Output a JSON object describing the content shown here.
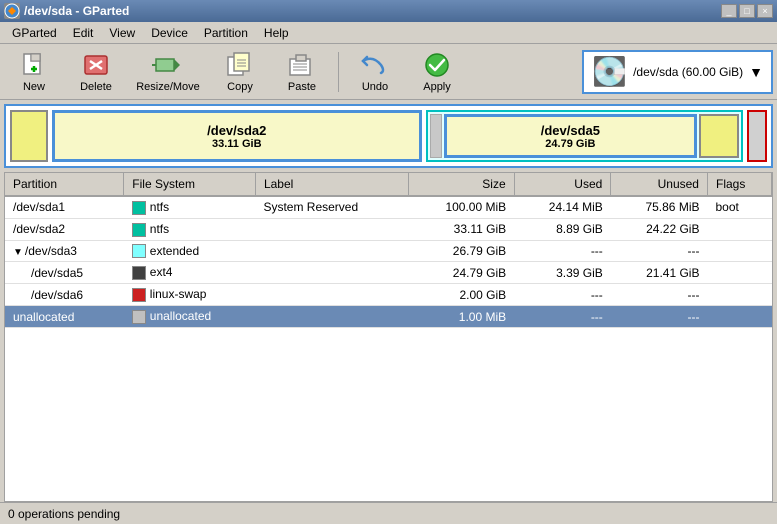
{
  "titlebar": {
    "title": "/dev/sda - GParted",
    "icon": "gparted-icon"
  },
  "menubar": {
    "items": [
      "GParted",
      "Edit",
      "View",
      "Device",
      "Partition",
      "Help"
    ]
  },
  "toolbar": {
    "buttons": [
      {
        "id": "new",
        "label": "New",
        "icon": "new-icon",
        "disabled": false
      },
      {
        "id": "delete",
        "label": "Delete",
        "icon": "delete-icon",
        "disabled": false
      },
      {
        "id": "resize",
        "label": "Resize/Move",
        "icon": "resize-icon",
        "disabled": false
      },
      {
        "id": "copy",
        "label": "Copy",
        "icon": "copy-icon",
        "disabled": false
      },
      {
        "id": "paste",
        "label": "Paste",
        "icon": "paste-icon",
        "disabled": false
      },
      {
        "id": "undo",
        "label": "Undo",
        "icon": "undo-icon",
        "disabled": false
      },
      {
        "id": "apply",
        "label": "Apply",
        "icon": "apply-icon",
        "disabled": false
      }
    ]
  },
  "device_selector": {
    "name": "/dev/sda",
    "size": "(60.00 GiB)"
  },
  "disk_visual": {
    "sda2_label": "/dev/sda2",
    "sda2_size": "33.11 GiB",
    "sda5_label": "/dev/sda5",
    "sda5_size": "24.79 GiB"
  },
  "table": {
    "headers": [
      "Partition",
      "File System",
      "Label",
      "Size",
      "Used",
      "Unused",
      "Flags"
    ],
    "rows": [
      {
        "partition": "/dev/sda1",
        "fs": "ntfs",
        "fs_color": "#00c0a0",
        "label": "System Reserved",
        "size": "100.00 MiB",
        "used": "24.14 MiB",
        "unused": "75.86 MiB",
        "flags": "boot",
        "indent": false,
        "tree": false,
        "selected": false
      },
      {
        "partition": "/dev/sda2",
        "fs": "ntfs",
        "fs_color": "#00c0a0",
        "label": "",
        "size": "33.11 GiB",
        "used": "8.89 GiB",
        "unused": "24.22 GiB",
        "flags": "",
        "indent": false,
        "tree": false,
        "selected": false
      },
      {
        "partition": "/dev/sda3",
        "fs": "extended",
        "fs_color": "#80ffff",
        "label": "",
        "size": "26.79 GiB",
        "used": "---",
        "unused": "---",
        "flags": "",
        "indent": false,
        "tree": true,
        "selected": false
      },
      {
        "partition": "/dev/sda5",
        "fs": "ext4",
        "fs_color": "#404040",
        "label": "",
        "size": "24.79 GiB",
        "used": "3.39 GiB",
        "unused": "21.41 GiB",
        "flags": "",
        "indent": true,
        "tree": false,
        "selected": false
      },
      {
        "partition": "/dev/sda6",
        "fs": "linux-swap",
        "fs_color": "#cc2020",
        "label": "",
        "size": "2.00 GiB",
        "used": "---",
        "unused": "---",
        "flags": "",
        "indent": true,
        "tree": false,
        "selected": false
      },
      {
        "partition": "unallocated",
        "fs": "unallocated",
        "fs_color": "#c0c0c0",
        "label": "",
        "size": "1.00 MiB",
        "used": "---",
        "unused": "---",
        "flags": "",
        "indent": false,
        "tree": false,
        "selected": true
      }
    ]
  },
  "statusbar": {
    "text": "0 operations pending"
  }
}
